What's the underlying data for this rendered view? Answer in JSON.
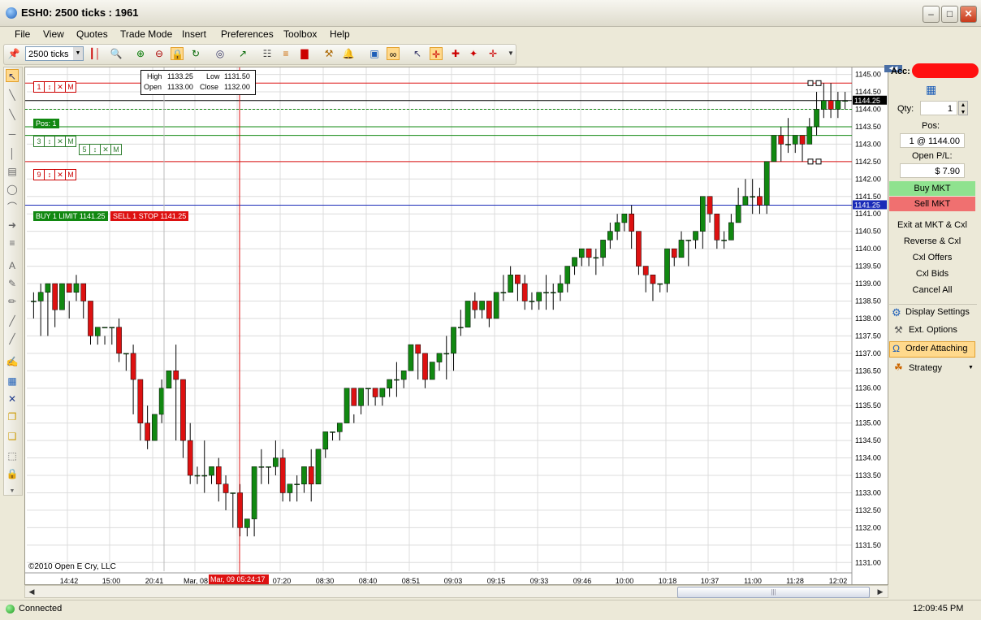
{
  "window": {
    "title": "ESH0: 2500 ticks : 1961",
    "min_glyph": "–",
    "max_glyph": "□",
    "close_glyph": "✕"
  },
  "menu": [
    "File",
    "View",
    "Quotes",
    "Trade Mode",
    "Insert",
    "Preferences",
    "Toolbox",
    "Help"
  ],
  "toolbar": {
    "ticks_value": "2500 ticks",
    "icons": [
      "pin-icon",
      "chart-type-icon",
      "zoom-icon",
      "zoom-in-icon",
      "zoom-out-icon",
      "lock-icon",
      "refresh-icon",
      "crosshair-icon",
      "indicator-icon",
      "tree-icon",
      "bar-color-icon",
      "volume-icon",
      "tools-icon",
      "alert-icon",
      "save-icon",
      "link-icon",
      "pointer-icon",
      "order-attach-icon",
      "add-line-icon",
      "add-marker-icon",
      "add-arrow-icon"
    ]
  },
  "info_box": {
    "high_label": "High",
    "high": "1133.25",
    "low_label": "Low",
    "low": "1131.50",
    "open_label": "Open",
    "open": "1133.00",
    "close_label": "Close",
    "close": "1132.00"
  },
  "orders": {
    "top_bracket": [
      "1",
      "↕",
      "✕",
      "M"
    ],
    "mid_bracket_a": [
      "3",
      "↕",
      "✕",
      "M"
    ],
    "mid_bracket_b": [
      "5",
      "↕",
      "✕",
      "M"
    ],
    "low_bracket": [
      "9",
      "↕",
      "✕",
      "M"
    ],
    "pos_tag": "Pos: 1",
    "buy_limit": "BUY 1 LIMIT 1141.25",
    "sell_stop": "SELL 1 STOP 1141.25"
  },
  "price_tags": {
    "current": "1144.25",
    "order_line": "1141.25"
  },
  "copyright": "©2010 Open E Cry, LLC",
  "cursor_time": "Mar, 09 05:24:17",
  "chart_data": {
    "type": "candlestick",
    "y_axis_ticks": [
      "1131.00",
      "1131.50",
      "1132.00",
      "1132.50",
      "1133.00",
      "1133.50",
      "1134.00",
      "1134.50",
      "1135.00",
      "1135.50",
      "1136.00",
      "1136.50",
      "1137.00",
      "1137.50",
      "1138.00",
      "1138.50",
      "1139.00",
      "1139.50",
      "1140.00",
      "1140.50",
      "1141.00",
      "1141.50",
      "1142.00",
      "1142.50",
      "1143.00",
      "1143.50",
      "1144.00",
      "1144.50",
      "1145.00"
    ],
    "ylim": [
      1130.75,
      1145.2
    ],
    "x_axis_labels": [
      "14:42",
      "15:00",
      "20:41",
      "Mar, 08",
      "07:20",
      "08:30",
      "08:40",
      "08:51",
      "09:03",
      "09:15",
      "09:33",
      "09:46",
      "10:00",
      "10:18",
      "10:37",
      "11:00",
      "11:28",
      "12:02"
    ],
    "levels": {
      "stop_red_top": 1144.75,
      "current_black": 1144.25,
      "position_dashed": 1144.0,
      "target_green_a": 1143.5,
      "target_green_b": 1143.25,
      "stop_red_low": 1142.5,
      "order_blue": 1141.25
    },
    "candles": [
      [
        1138.75,
        1138.5,
        1138.0
      ],
      [
        1139.0,
        1138.75,
        1137.5
      ],
      [
        1138.75,
        1139.0,
        1137.5
      ],
      [
        1138.75,
        1138.25,
        1137.75
      ],
      [
        1138.75,
        1139.0,
        1138.25
      ],
      [
        1138.5,
        1138.75,
        1138.0
      ],
      [
        1139.25,
        1139.0,
        1138.5
      ],
      [
        1138.75,
        1138.5,
        1138.0
      ],
      [
        1138.5,
        1137.5,
        1137.25
      ],
      [
        1137.5,
        1137.75,
        1137.25
      ],
      [
        1137.5,
        1137.75,
        1137.25
      ],
      [
        1137.75,
        1137.75,
        1137.25
      ],
      [
        1138.0,
        1137.0,
        1136.75
      ],
      [
        1137.0,
        1137.0,
        1136.5
      ],
      [
        1137.25,
        1136.25,
        1135.25
      ],
      [
        1136.25,
        1135.0,
        1134.5
      ],
      [
        1135.5,
        1134.5,
        1134.25
      ],
      [
        1134.5,
        1135.25,
        1134.5
      ],
      [
        1136.25,
        1136.0,
        1135.0
      ],
      [
        1136.25,
        1136.5,
        1136.0
      ],
      [
        1137.25,
        1136.25,
        1134.5
      ],
      [
        1135.5,
        1134.5,
        1134.0
      ],
      [
        1135.0,
        1133.5,
        1133.25
      ],
      [
        1133.75,
        1133.5,
        1133.25
      ],
      [
        1134.5,
        1133.5,
        1133.0
      ],
      [
        1133.5,
        1133.75,
        1133.25
      ],
      [
        1134.0,
        1133.25,
        1132.75
      ],
      [
        1133.5,
        1133.0,
        1132.5
      ],
      [
        1133.0,
        1133.0,
        1132.0
      ],
      [
        1133.25,
        1132.0,
        1131.75
      ],
      [
        1132.0,
        1132.25,
        1131.75
      ],
      [
        1132.25,
        1133.75,
        1131.75
      ],
      [
        1134.25,
        1133.75,
        1133.25
      ],
      [
        1133.75,
        1133.75,
        1133.25
      ],
      [
        1134.5,
        1134.0,
        1133.5
      ],
      [
        1134.25,
        1133.0,
        1132.75
      ],
      [
        1133.0,
        1133.25,
        1132.75
      ],
      [
        1133.5,
        1133.25,
        1132.75
      ],
      [
        1133.25,
        1133.75,
        1133.0
      ],
      [
        1134.25,
        1133.25,
        1132.75
      ],
      [
        1133.25,
        1134.25,
        1133.25
      ],
      [
        1134.75,
        1134.75,
        1134.0
      ],
      [
        1134.75,
        1134.75,
        1134.5
      ],
      [
        1134.75,
        1135.0,
        1134.5
      ],
      [
        1135.0,
        1136.0,
        1135.0
      ],
      [
        1135.25,
        1135.5,
        1135.0
      ],
      [
        1135.75,
        1136.0,
        1135.25
      ],
      [
        1136.0,
        1136.0,
        1135.5
      ],
      [
        1136.0,
        1135.75,
        1135.5
      ],
      [
        1135.75,
        1136.0,
        1135.5
      ],
      [
        1136.25,
        1136.25,
        1135.75
      ],
      [
        1136.75,
        1136.25,
        1135.75
      ],
      [
        1136.25,
        1136.5,
        1136.0
      ],
      [
        1136.5,
        1137.25,
        1136.5
      ],
      [
        1137.25,
        1137.0,
        1136.25
      ],
      [
        1137.0,
        1136.25,
        1136.0
      ],
      [
        1136.25,
        1136.75,
        1136.25
      ],
      [
        1136.75,
        1137.0,
        1136.5
      ],
      [
        1137.5,
        1137.0,
        1136.25
      ],
      [
        1137.0,
        1137.75,
        1136.5
      ],
      [
        1138.25,
        1137.75,
        1137.5
      ],
      [
        1137.75,
        1138.5,
        1137.75
      ],
      [
        1138.75,
        1138.25,
        1138.0
      ],
      [
        1138.5,
        1138.5,
        1138.0
      ],
      [
        1138.5,
        1138.0,
        1137.75
      ],
      [
        1138.5,
        1138.75,
        1138.0
      ],
      [
        1139.25,
        1138.75,
        1138.5
      ],
      [
        1139.5,
        1139.25,
        1138.75
      ],
      [
        1139.25,
        1139.0,
        1138.5
      ],
      [
        1139.25,
        1138.5,
        1138.25
      ],
      [
        1138.75,
        1138.5,
        1138.25
      ],
      [
        1138.5,
        1138.75,
        1138.25
      ],
      [
        1139.25,
        1138.75,
        1138.25
      ],
      [
        1139.0,
        1138.75,
        1138.25
      ],
      [
        1139.25,
        1139.0,
        1138.5
      ],
      [
        1139.5,
        1139.5,
        1138.75
      ],
      [
        1139.75,
        1139.75,
        1139.25
      ],
      [
        1140.0,
        1140.0,
        1139.5
      ],
      [
        1139.75,
        1139.75,
        1139.5
      ],
      [
        1140.0,
        1139.75,
        1139.25
      ],
      [
        1140.25,
        1140.25,
        1139.5
      ],
      [
        1140.75,
        1140.5,
        1140.0
      ],
      [
        1141.0,
        1140.75,
        1140.25
      ],
      [
        1141.0,
        1141.0,
        1140.5
      ],
      [
        1141.25,
        1140.5,
        1140.0
      ],
      [
        1140.0,
        1139.5,
        1139.25
      ],
      [
        1139.5,
        1139.25,
        1138.75
      ],
      [
        1139.25,
        1139.0,
        1138.5
      ],
      [
        1139.0,
        1139.0,
        1138.75
      ],
      [
        1139.25,
        1140.0,
        1138.75
      ],
      [
        1140.0,
        1139.75,
        1139.5
      ],
      [
        1140.5,
        1140.25,
        1139.75
      ],
      [
        1140.25,
        1140.25,
        1139.5
      ],
      [
        1140.5,
        1140.5,
        1140.0
      ],
      [
        1141.5,
        1141.5,
        1140.0
      ],
      [
        1141.5,
        1141.0,
        1140.75
      ],
      [
        1141.0,
        1140.25,
        1140.0
      ],
      [
        1140.5,
        1140.25,
        1140.0
      ],
      [
        1141.0,
        1140.75,
        1140.25
      ],
      [
        1141.75,
        1141.25,
        1141.0
      ],
      [
        1142.0,
        1141.5,
        1141.25
      ],
      [
        1142.0,
        1141.5,
        1141.0
      ],
      [
        1141.75,
        1141.25,
        1141.0
      ],
      [
        1142.0,
        1142.5,
        1141.0
      ],
      [
        1143.0,
        1143.25,
        1142.5
      ],
      [
        1143.5,
        1143.0,
        1142.5
      ],
      [
        1143.75,
        1143.0,
        1142.75
      ],
      [
        1143.25,
        1143.25,
        1142.75
      ],
      [
        1143.25,
        1143.0,
        1142.5
      ],
      [
        1143.75,
        1143.5,
        1143.0
      ],
      [
        1144.5,
        1144.0,
        1143.25
      ],
      [
        1144.75,
        1144.25,
        1143.75
      ],
      [
        1144.75,
        1144.0,
        1143.75
      ],
      [
        1144.5,
        1144.25,
        1143.75
      ],
      [
        1144.5,
        1144.25,
        1144.0
      ]
    ]
  },
  "panel": {
    "acc_label": "Acc:",
    "qty_label": "Qty:",
    "qty_value": "1",
    "pos_label": "Pos:",
    "pos_value": "1 @ 1144.00",
    "pl_label": "Open P/L:",
    "pl_value": "$ 7.90",
    "buy_mkt": "Buy MKT",
    "sell_mkt": "Sell MKT",
    "actions": [
      "Exit at MKT & Cxl",
      "Reverse & Cxl",
      "Cxl Offers",
      "Cxl Bids",
      "Cancel All"
    ],
    "display_settings": "Display Settings",
    "ext_options": "Ext. Options",
    "order_attaching": "Order Attaching",
    "strategy": "Strategy",
    "buy_color": "#8fe28f",
    "sell_color": "#f07070",
    "accent_color": "#ffd98c"
  },
  "status": {
    "connected": "Connected",
    "time": "12:09:45 PM"
  },
  "colors": {
    "up": "#118811",
    "down": "#dd1111",
    "grid": "#dcdcdc"
  }
}
